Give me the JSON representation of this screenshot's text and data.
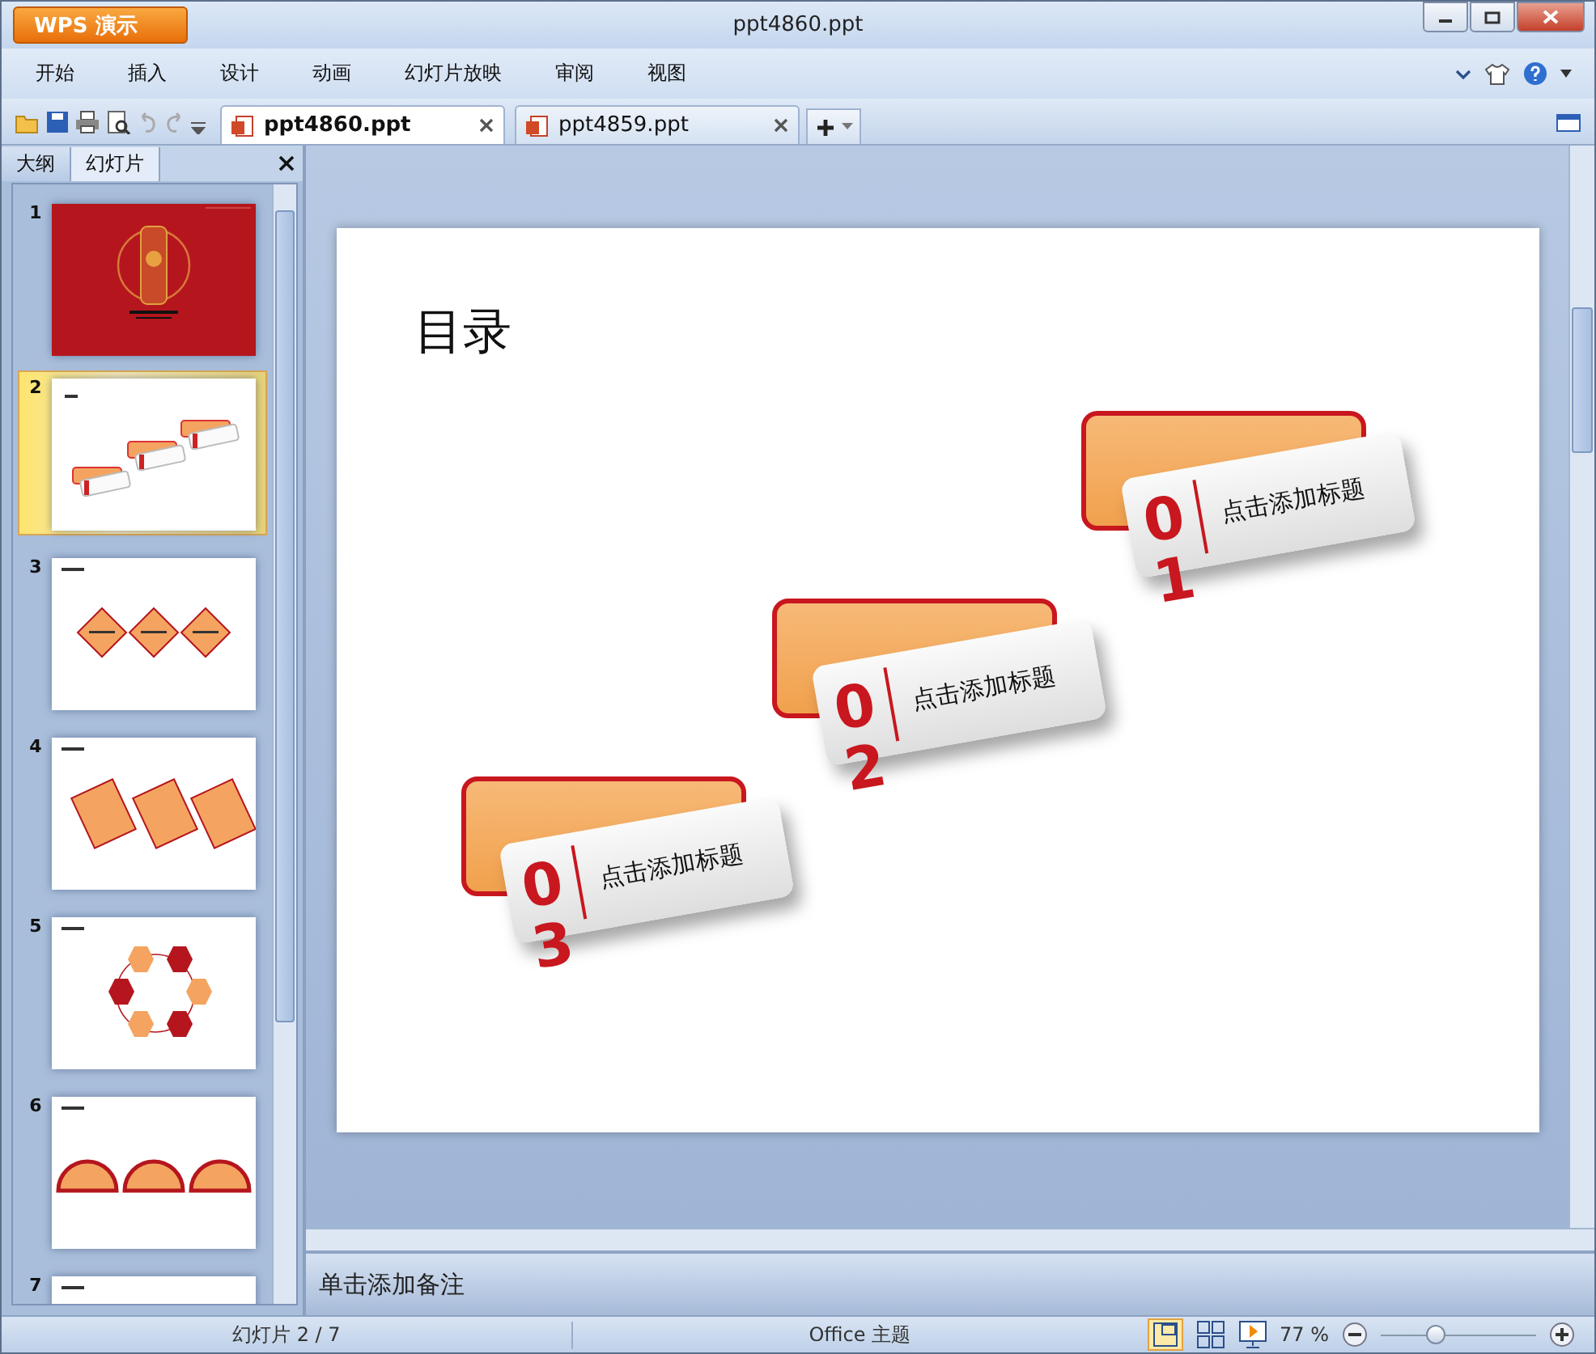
{
  "window": {
    "app_button": "WPS 演示",
    "title": "ppt4860.ppt"
  },
  "menu": [
    "开始",
    "插入",
    "设计",
    "动画",
    "幻灯片放映",
    "审阅",
    "视图"
  ],
  "doc_tabs": [
    {
      "label": "ppt4860.ppt",
      "selected": true
    },
    {
      "label": "ppt4859.ppt",
      "selected": false
    }
  ],
  "panel_tabs": [
    {
      "label": "大纲",
      "selected": false
    },
    {
      "label": "幻灯片",
      "selected": true
    }
  ],
  "thumbnails": [
    {
      "number": "1",
      "kind": "cover",
      "selected": false
    },
    {
      "number": "2",
      "kind": "toc",
      "selected": true
    },
    {
      "number": "3",
      "kind": "diamonds",
      "selected": false
    },
    {
      "number": "4",
      "kind": "cards",
      "selected": false
    },
    {
      "number": "5",
      "kind": "hexagons",
      "selected": false
    },
    {
      "number": "6",
      "kind": "circles",
      "selected": false
    },
    {
      "number": "7",
      "kind": "title",
      "selected": false
    }
  ],
  "slide": {
    "title": "目录",
    "items": [
      {
        "number": "01",
        "label": "点击添加标题"
      },
      {
        "number": "02",
        "label": "点击添加标题"
      },
      {
        "number": "03",
        "label": "点击添加标题"
      }
    ]
  },
  "notes": {
    "placeholder": "单击添加备注"
  },
  "status_bar": {
    "slide_counter": "幻灯片 2 / 7",
    "theme": "Office 主题",
    "zoom": "77 %",
    "zoom_slider": {
      "level": 0.35
    }
  }
}
